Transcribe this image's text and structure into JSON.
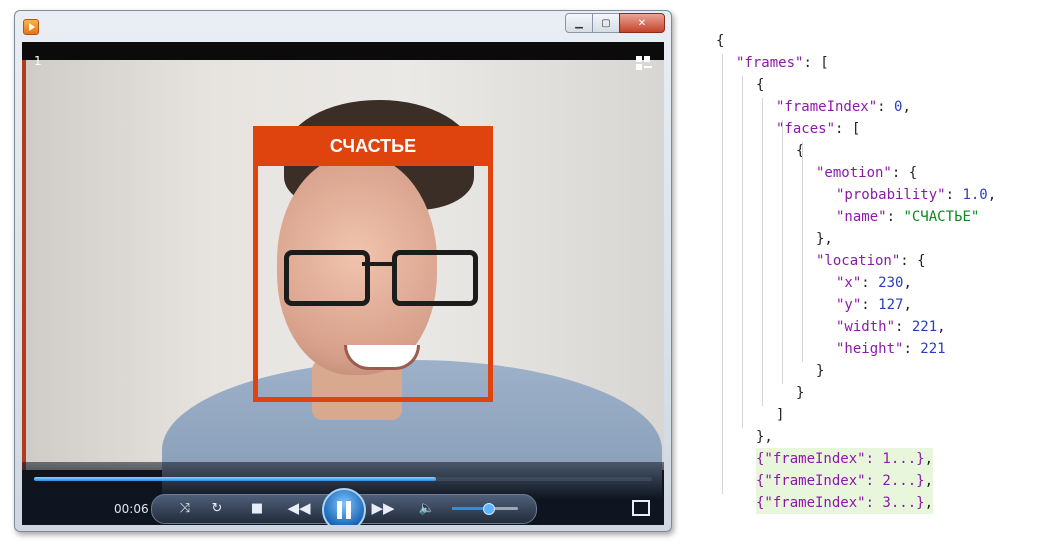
{
  "player": {
    "track_number": "1",
    "current_time": "00:06",
    "seek_progress": 0.65,
    "volume_level": 0.55,
    "face_label": "СЧАСТЬЕ",
    "accent": "#e0440e"
  },
  "json_panel": {
    "lines": [
      {
        "indent": 0,
        "parts": [
          {
            "t": "{",
            "c": "p"
          }
        ]
      },
      {
        "indent": 1,
        "parts": [
          {
            "t": "\"frames\"",
            "c": "k"
          },
          {
            "t": ": [",
            "c": "p"
          }
        ]
      },
      {
        "indent": 2,
        "parts": [
          {
            "t": "{",
            "c": "p"
          }
        ]
      },
      {
        "indent": 3,
        "parts": [
          {
            "t": "\"frameIndex\"",
            "c": "k"
          },
          {
            "t": ": ",
            "c": "p"
          },
          {
            "t": "0",
            "c": "n"
          },
          {
            "t": ",",
            "c": "p"
          }
        ]
      },
      {
        "indent": 3,
        "parts": [
          {
            "t": "\"faces\"",
            "c": "k"
          },
          {
            "t": ": [",
            "c": "p"
          }
        ]
      },
      {
        "indent": 4,
        "parts": [
          {
            "t": "{",
            "c": "p"
          }
        ]
      },
      {
        "indent": 5,
        "parts": [
          {
            "t": "\"emotion\"",
            "c": "k"
          },
          {
            "t": ": {",
            "c": "p"
          }
        ]
      },
      {
        "indent": 6,
        "parts": [
          {
            "t": "\"probability\"",
            "c": "k"
          },
          {
            "t": ": ",
            "c": "p"
          },
          {
            "t": "1.0",
            "c": "n"
          },
          {
            "t": ",",
            "c": "p"
          }
        ]
      },
      {
        "indent": 6,
        "parts": [
          {
            "t": "\"name\"",
            "c": "k"
          },
          {
            "t": ": ",
            "c": "p"
          },
          {
            "t": "\"СЧАСТЬЕ\"",
            "c": "s"
          }
        ]
      },
      {
        "indent": 5,
        "parts": [
          {
            "t": "},",
            "c": "p"
          }
        ]
      },
      {
        "indent": 5,
        "parts": [
          {
            "t": "\"location\"",
            "c": "k"
          },
          {
            "t": ": {",
            "c": "p"
          }
        ]
      },
      {
        "indent": 6,
        "parts": [
          {
            "t": "\"x\"",
            "c": "k"
          },
          {
            "t": ": ",
            "c": "p"
          },
          {
            "t": "230",
            "c": "n"
          },
          {
            "t": ",",
            "c": "p"
          }
        ]
      },
      {
        "indent": 6,
        "parts": [
          {
            "t": "\"y\"",
            "c": "k"
          },
          {
            "t": ": ",
            "c": "p"
          },
          {
            "t": "127",
            "c": "n"
          },
          {
            "t": ",",
            "c": "p"
          }
        ]
      },
      {
        "indent": 6,
        "parts": [
          {
            "t": "\"width\"",
            "c": "k"
          },
          {
            "t": ": ",
            "c": "p"
          },
          {
            "t": "221",
            "c": "n"
          },
          {
            "t": ",",
            "c": "p"
          }
        ]
      },
      {
        "indent": 6,
        "parts": [
          {
            "t": "\"height\"",
            "c": "k"
          },
          {
            "t": ": ",
            "c": "p"
          },
          {
            "t": "221",
            "c": "n"
          }
        ]
      },
      {
        "indent": 5,
        "parts": [
          {
            "t": "}",
            "c": "p"
          }
        ]
      },
      {
        "indent": 4,
        "parts": [
          {
            "t": "}",
            "c": "p"
          }
        ]
      },
      {
        "indent": 3,
        "parts": [
          {
            "t": "]",
            "c": "p"
          }
        ]
      },
      {
        "indent": 2,
        "parts": [
          {
            "t": "},",
            "c": "p"
          }
        ]
      },
      {
        "indent": 2,
        "collapsed": true,
        "parts": [
          {
            "t": "{\"frameIndex\": 1...}",
            "c": "k"
          },
          {
            "t": ",",
            "c": "p"
          }
        ]
      },
      {
        "indent": 2,
        "collapsed": true,
        "parts": [
          {
            "t": "{\"frameIndex\": 2...}",
            "c": "k"
          },
          {
            "t": ",",
            "c": "p"
          }
        ]
      },
      {
        "indent": 2,
        "collapsed": true,
        "parts": [
          {
            "t": "{\"frameIndex\": 3...}",
            "c": "k"
          },
          {
            "t": ",",
            "c": "p"
          }
        ]
      }
    ]
  }
}
